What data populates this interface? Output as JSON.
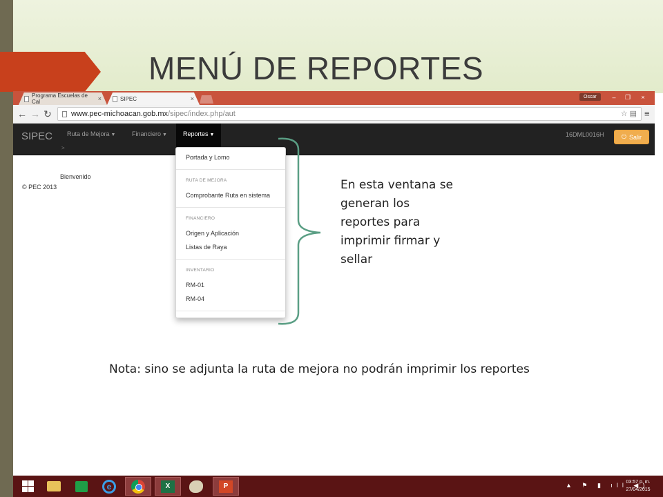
{
  "slide": {
    "title": "MENÚ DE REPORTES",
    "callout": "En esta ventana se generan los reportes para imprimir firmar y sellar",
    "note": "Nota: sino se adjunta la ruta de mejora no podrán imprimir los reportes"
  },
  "browser": {
    "tabs": [
      {
        "label": "Programa Escuelas de Cal",
        "close": "×"
      },
      {
        "label": "SIPEC",
        "close": "×"
      }
    ],
    "user": "Oscar",
    "window_controls": {
      "minimize": "–",
      "maximize": "❐",
      "close": "×"
    },
    "url_host": "www.pec-michoacan.gob.mx",
    "url_path": "/sipec/index.php/aut"
  },
  "app": {
    "brand": "SIPEC",
    "nav": [
      {
        "label": "Ruta de Mejora"
      },
      {
        "label": "Financiero"
      },
      {
        "label": "Reportes"
      }
    ],
    "breadcrumb_chevron": ">",
    "school_code": "16DML0016H",
    "logout_label": "Salir",
    "welcome": "Bienvenido",
    "footer": "© PEC 2013"
  },
  "dropdown": {
    "items": {
      "portada": "Portada y Lomo",
      "header_ruta": "RUTA DE MEJORA",
      "comprobante": "Comprobante Ruta en sistema",
      "header_financiero": "FINANCIERO",
      "origen": "Origen y Aplicación",
      "listas": "Listas de Raya",
      "header_inventario": "INVENTARIO",
      "rm01": "RM-01",
      "rm04": "RM-04"
    }
  },
  "taskbar": {
    "icons": [
      "start-icon",
      "file-explorer-icon",
      "store-icon",
      "internet-explorer-icon",
      "chrome-icon",
      "excel-icon",
      "paint-icon",
      "powerpoint-icon"
    ],
    "excel_letter": "X",
    "powerpoint_letter": "P",
    "time": "03:57 p. m.",
    "date": "27/04/2015"
  },
  "colors": {
    "slide_accent": "#c8401c",
    "navbar": "#222222",
    "logout_button": "#f0ad4e",
    "brace": "#5a9e84",
    "taskbar": "#5a1414"
  }
}
